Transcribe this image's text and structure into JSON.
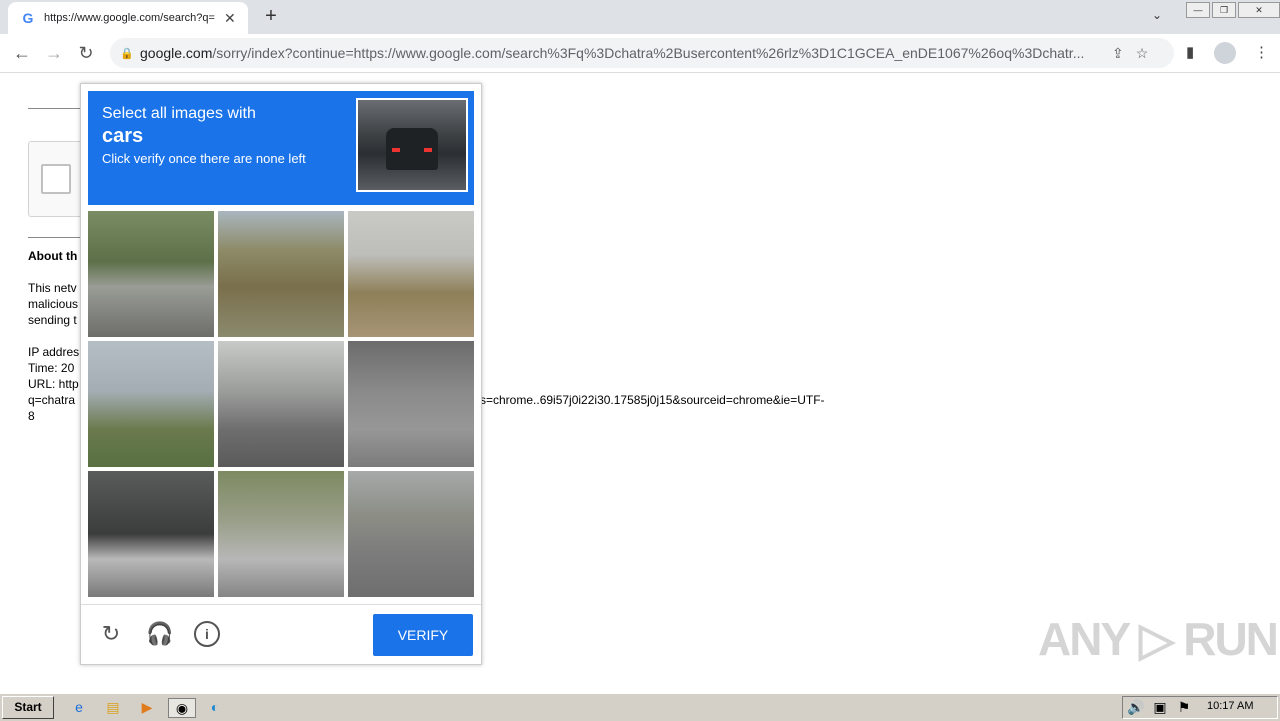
{
  "browser": {
    "tab_title": "https://www.google.com/search?q=",
    "favicon": "G",
    "url_host": "google.com",
    "url_path": "/sorry/index?continue=https://www.google.com/search%3Fq%3Dchatra%2Busercontent%26rlz%3D1C1GCEA_enDE1067%26oq%3Dchatr..."
  },
  "page": {
    "about_heading": "About th",
    "line1": "This netv",
    "line2": "malicious",
    "line3": "sending t",
    "ip": "IP addres",
    "time": "Time: 20",
    "url": "URL: http",
    "q_line": "q=chatra",
    "q_tail": "s=chrome..69i57j0i22i30.17585j0j15&sourceid=chrome&ie=UTF-",
    "last": "8"
  },
  "challenge": {
    "line1": "Select all images with",
    "target": "cars",
    "line3": "Click verify once there are none left",
    "verify_label": "VERIFY",
    "footer_icons": [
      "reload-icon",
      "headphones-icon",
      "info-icon"
    ]
  },
  "watermark": "ANY ▷ RUN",
  "taskbar": {
    "start_label": "Start",
    "clock": "10:17 AM"
  }
}
